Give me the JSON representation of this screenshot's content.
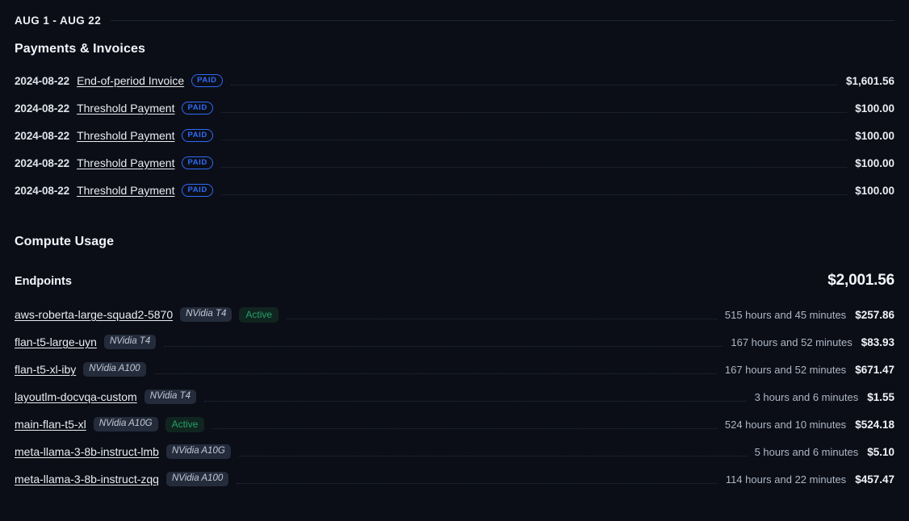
{
  "header": {
    "period_label": "AUG 1 - AUG 22"
  },
  "payments_section": {
    "title": "Payments & Invoices",
    "rows": [
      {
        "date": "2024-08-22",
        "name": "End-of-period Invoice",
        "status": "PAID",
        "amount": "$1,601.56"
      },
      {
        "date": "2024-08-22",
        "name": "Threshold Payment",
        "status": "PAID",
        "amount": "$100.00"
      },
      {
        "date": "2024-08-22",
        "name": "Threshold Payment",
        "status": "PAID",
        "amount": "$100.00"
      },
      {
        "date": "2024-08-22",
        "name": "Threshold Payment",
        "status": "PAID",
        "amount": "$100.00"
      },
      {
        "date": "2024-08-22",
        "name": "Threshold Payment",
        "status": "PAID",
        "amount": "$100.00"
      }
    ]
  },
  "compute_section": {
    "title": "Compute Usage",
    "endpoints_label": "Endpoints",
    "endpoints_total": "$2,001.56",
    "endpoints": [
      {
        "name": "aws-roberta-large-squad2-5870",
        "gpu": "NVidia T4",
        "state": "Active",
        "duration": "515 hours and 45 minutes",
        "amount": "$257.86"
      },
      {
        "name": "flan-t5-large-uyn",
        "gpu": "NVidia T4",
        "state": "",
        "duration": "167 hours and 52 minutes",
        "amount": "$83.93"
      },
      {
        "name": "flan-t5-xl-iby",
        "gpu": "NVidia A100",
        "state": "",
        "duration": "167 hours and 52 minutes",
        "amount": "$671.47"
      },
      {
        "name": "layoutlm-docvqa-custom",
        "gpu": "NVidia T4",
        "state": "",
        "duration": "3 hours and 6 minutes",
        "amount": "$1.55"
      },
      {
        "name": "main-flan-t5-xl",
        "gpu": "NVidia A10G",
        "state": "Active",
        "duration": "524 hours and 10 minutes",
        "amount": "$524.18"
      },
      {
        "name": "meta-llama-3-8b-instruct-lmb",
        "gpu": "NVidia A10G",
        "state": "",
        "duration": "5 hours and 6 minutes",
        "amount": "$5.10"
      },
      {
        "name": "meta-llama-3-8b-instruct-zqq",
        "gpu": "NVidia A100",
        "state": "",
        "duration": "114 hours and 22 minutes",
        "amount": "$457.47"
      }
    ]
  },
  "colors": {
    "background": "#0b0e17",
    "paid_badge": "#2f6bf6",
    "active_badge_text": "#25a06a",
    "gpu_badge_bg": "#242c3b"
  }
}
